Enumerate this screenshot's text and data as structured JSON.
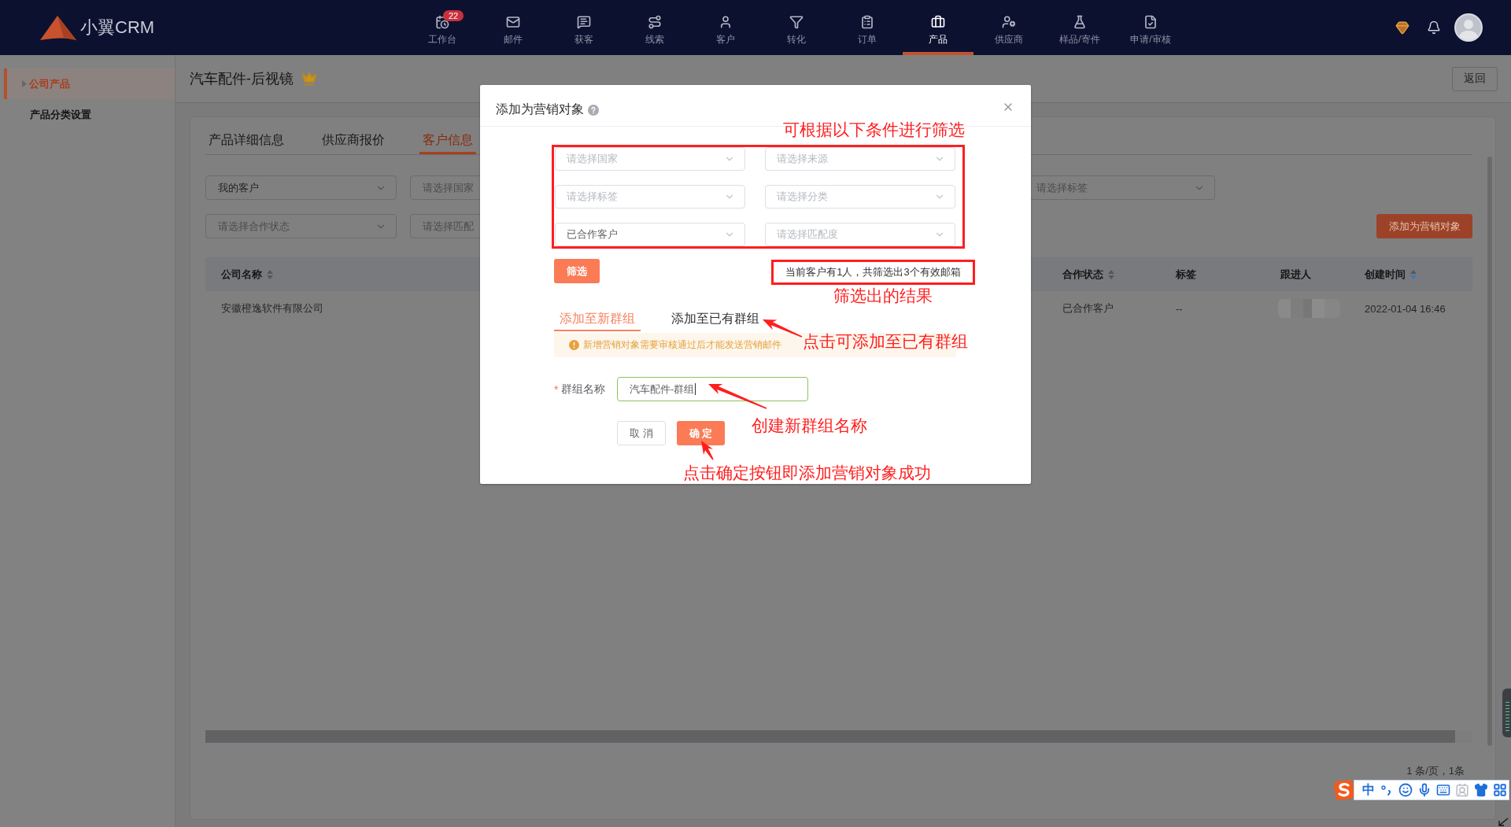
{
  "topbar": {
    "logo": "小翼CRM",
    "nav": [
      {
        "label": "工作台",
        "badge": "22",
        "selected": false
      },
      {
        "label": "邮件",
        "selected": false
      },
      {
        "label": "获客",
        "selected": false
      },
      {
        "label": "线索",
        "selected": false
      },
      {
        "label": "客户",
        "selected": false
      },
      {
        "label": "转化",
        "selected": false
      },
      {
        "label": "订单",
        "selected": false
      },
      {
        "label": "产品",
        "selected": true
      },
      {
        "label": "供应商",
        "selected": false
      },
      {
        "label": "样品/寄件",
        "selected": false
      },
      {
        "label": "申请/审核",
        "selected": false
      }
    ]
  },
  "sidebar": {
    "items": [
      {
        "label": "公司产品",
        "selected": true
      },
      {
        "label": "产品分类设置",
        "selected": false
      }
    ]
  },
  "header": {
    "title": "汽车配件-后视镜",
    "back_button": "返回"
  },
  "tabs": [
    {
      "label": "产品详细信息",
      "selected": false
    },
    {
      "label": "供应商报价",
      "selected": false
    },
    {
      "label": "客户信息",
      "selected": true
    }
  ],
  "filters": {
    "rows": [
      {
        "fields": [
          {
            "value": "我的客户"
          },
          {
            "placeholder": "请选择国家"
          }
        ],
        "end_field": {
          "placeholder": "请选择标签"
        }
      },
      {
        "fields": [
          {
            "placeholder": "请选择合作状态"
          },
          {
            "placeholder": "请选择匹配"
          }
        ],
        "end_button": "添加为营销对象"
      }
    ]
  },
  "table": {
    "columns": [
      {
        "label": "公司名称",
        "sortable": true,
        "descending": false
      },
      {
        "label": "合作状态",
        "sortable": true,
        "descending": false
      },
      {
        "label": "标签",
        "sortable": false
      },
      {
        "label": "跟进人",
        "sortable": false
      },
      {
        "label": "创建时间",
        "sortable": true,
        "descending": true
      }
    ],
    "rows": [
      {
        "cells": [
          {
            "kind": "text",
            "text": "安徽橙逸软件有限公司"
          },
          {
            "kind": "text",
            "text": "已合作客户"
          },
          {
            "kind": "text",
            "text": "--"
          },
          {
            "kind": "blurred"
          },
          {
            "kind": "text",
            "text": "2022-01-04 16:46"
          }
        ]
      }
    ]
  },
  "pagination": {
    "summary": "1 条/页，1条"
  },
  "modal": {
    "title": "添加为营销对象",
    "filter_note": "可根据以下条件进行筛选",
    "selects": [
      {
        "placeholder": "请选择国家"
      },
      {
        "placeholder": "请选择来源"
      },
      {
        "placeholder": "请选择标签"
      },
      {
        "placeholder": "请选择分类"
      },
      {
        "value": "已合作客户"
      },
      {
        "placeholder": "请选择匹配度"
      }
    ],
    "filter_button": "筛选",
    "result": "当前客户有1人，共筛选出3个有效邮箱",
    "result_note": "筛选出的结果",
    "tabs": [
      {
        "label": "添加至新群组",
        "selected": true
      },
      {
        "label": "添加至已有群组",
        "selected": false
      }
    ],
    "tab_note": "点击可添加至已有群组",
    "warning": "新增营销对象需要审核通过后才能发送营销邮件",
    "form": {
      "required_mark": "*",
      "label": "群组名称",
      "value": "汽车配件-群组"
    },
    "input_note": "创建新群组名称",
    "cancel_button": "取 消",
    "confirm_button": "确 定",
    "confirm_note": "点击确定按钮即添加营销对象成功"
  },
  "ime_bar": {
    "mode": "中"
  }
}
